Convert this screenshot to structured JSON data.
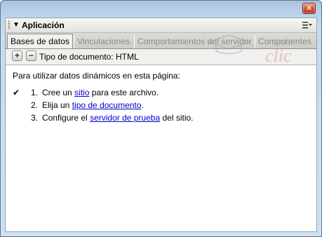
{
  "window": {
    "close_glyph": "✕"
  },
  "panel": {
    "title": "Aplicación",
    "collapse_icon": "triangle-down",
    "options_icon": "panel-options-menu"
  },
  "tabs": [
    {
      "label": "Bases de datos",
      "active": true
    },
    {
      "label": "Vinculaciones",
      "active": false
    },
    {
      "label": "Comportamientos del servidor",
      "active": false
    },
    {
      "label": "Componentes",
      "active": false
    }
  ],
  "watermark": {
    "line1": "aula",
    "line2": "clic"
  },
  "toolbar": {
    "add_label": "+",
    "remove_label": "−",
    "document_type": "Tipo de documento: HTML"
  },
  "content": {
    "intro": "Para utilizar datos dinámicos en esta página:",
    "check_glyph": "✔",
    "steps": [
      {
        "number": "1.",
        "before": "Cree un",
        "link": "sitio",
        "after": "para este archivo.",
        "done": true
      },
      {
        "number": "2.",
        "before": "Elija un",
        "link": "tipo de documento",
        "after": ".",
        "done": false
      },
      {
        "number": "3.",
        "before": "Configure el",
        "link": "servidor de prueba",
        "after": "del sitio.",
        "done": false
      }
    ]
  },
  "colors": {
    "link": "#0000cc",
    "close": "#c9472a",
    "titlebar": "#b8cfe6"
  }
}
